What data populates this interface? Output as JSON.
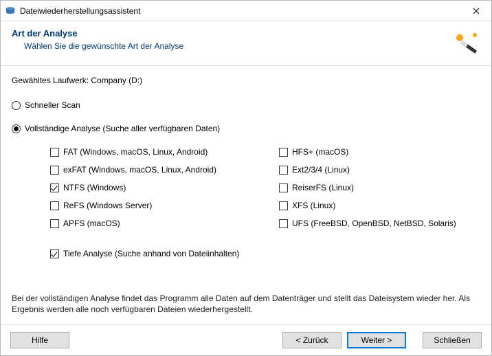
{
  "window": {
    "title": "Dateiwiederherstellungsassistent"
  },
  "header": {
    "title": "Art der Analyse",
    "subtitle": "Wählen Sie die gewünschte Art der Analyse"
  },
  "drive": {
    "label": "Gewähltes Laufwerk: Company (D:)"
  },
  "scan": {
    "quick": {
      "label": "Schneller Scan",
      "selected": false
    },
    "full": {
      "label": "Vollständige Analyse (Suche aller verfügbaren Daten)",
      "selected": true
    }
  },
  "filesystems": {
    "left": [
      {
        "label": "FAT (Windows, macOS, Linux, Android)",
        "checked": false
      },
      {
        "label": "exFAT (Windows, macOS, Linux, Android)",
        "checked": false
      },
      {
        "label": "NTFS (Windows)",
        "checked": true
      },
      {
        "label": "ReFS (Windows Server)",
        "checked": false
      },
      {
        "label": "APFS (macOS)",
        "checked": false
      }
    ],
    "right": [
      {
        "label": "HFS+ (macOS)",
        "checked": false
      },
      {
        "label": "Ext2/3/4 (Linux)",
        "checked": false
      },
      {
        "label": "ReiserFS (Linux)",
        "checked": false
      },
      {
        "label": "XFS (Linux)",
        "checked": false
      },
      {
        "label": "UFS (FreeBSD, OpenBSD, NetBSD, Solaris)",
        "checked": false
      }
    ]
  },
  "deep": {
    "label": "Tiefe Analyse (Suche anhand von Dateiinhalten)",
    "checked": true
  },
  "description": "Bei der vollständigen Analyse findet das Programm alle Daten auf dem Datenträger und stellt das Dateisystem wieder her. Als Ergebnis werden alle noch verfügbaren Dateien wiederhergestellt.",
  "buttons": {
    "help": "Hilfe",
    "back": "< Zurück",
    "next": "Weiter >",
    "close": "Schließen"
  }
}
